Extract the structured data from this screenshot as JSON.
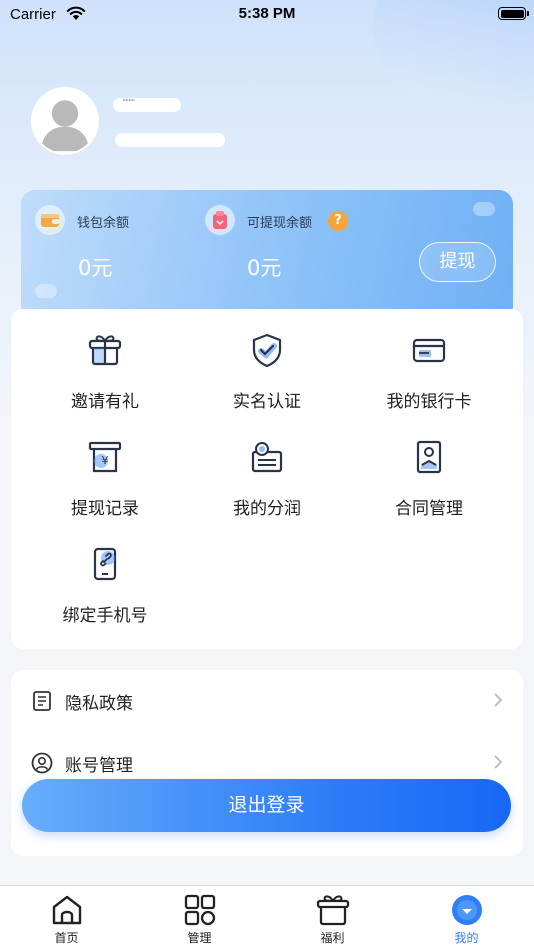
{
  "status_bar": {
    "carrier": "Carrier",
    "time": "5:38 PM"
  },
  "profile": {
    "name_masked": "········",
    "avatar_icon": "default-avatar-icon"
  },
  "wallet": {
    "balance_label": "钱包余额",
    "balance_value": "0元",
    "withdrawable_label": "可提现余额",
    "withdrawable_value": "0元",
    "help_glyph": "?",
    "withdraw_button": "提现"
  },
  "features": [
    {
      "label": "邀请有礼",
      "icon": "gift-icon"
    },
    {
      "label": "实名认证",
      "icon": "shield-check-icon"
    },
    {
      "label": "我的银行卡",
      "icon": "bank-card-icon"
    },
    {
      "label": "提现记录",
      "icon": "withdraw-record-icon"
    },
    {
      "label": "我的分润",
      "icon": "profit-share-icon"
    },
    {
      "label": "合同管理",
      "icon": "contract-icon"
    },
    {
      "label": "绑定手机号",
      "icon": "phone-link-icon"
    }
  ],
  "settings": [
    {
      "label": "隐私政策",
      "icon": "document-icon"
    },
    {
      "label": "账号管理",
      "icon": "user-circle-icon"
    }
  ],
  "logout_button": "退出登录",
  "tabs": [
    {
      "label": "首页",
      "icon": "home-icon"
    },
    {
      "label": "管理",
      "icon": "grid-icon"
    },
    {
      "label": "福利",
      "icon": "gift-icon"
    },
    {
      "label": "我的",
      "icon": "profile-icon",
      "active": true
    }
  ],
  "colors": {
    "accent": "#2f7ff8",
    "help": "#f3a53a",
    "card_blue": "#95c6f9"
  }
}
